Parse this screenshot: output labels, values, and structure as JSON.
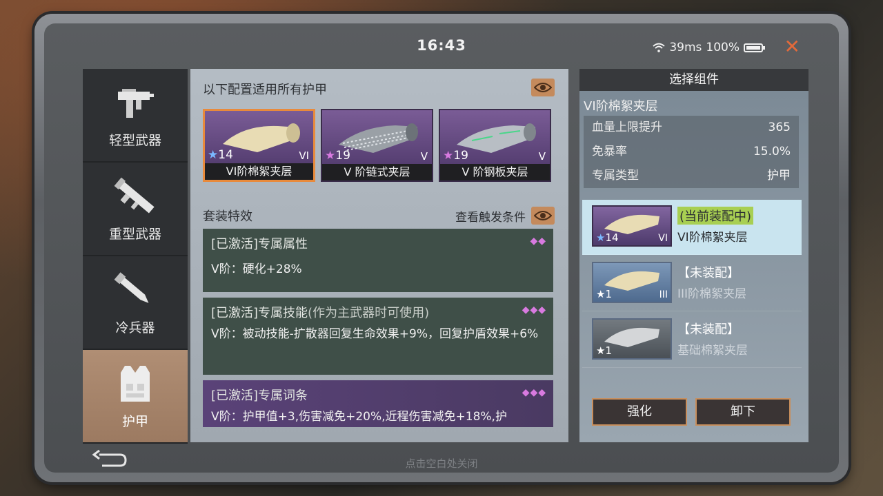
{
  "status": {
    "time": "16:43",
    "ping": "39ms",
    "battery": "100%"
  },
  "sidebar": {
    "items": [
      {
        "label": "轻型武器",
        "icon": "smg-icon"
      },
      {
        "label": "重型武器",
        "icon": "launcher-icon"
      },
      {
        "label": "冷兵器",
        "icon": "knife-icon"
      },
      {
        "label": "护甲",
        "icon": "vest-icon"
      }
    ]
  },
  "main": {
    "title": "以下配置适用所有护甲",
    "cards": [
      {
        "stars": "14",
        "tier": "VI",
        "name": "VI阶棉絮夹层"
      },
      {
        "stars": "19",
        "tier": "V",
        "name": "V 阶链式夹层"
      },
      {
        "stars": "19",
        "tier": "V",
        "name": "V 阶钢板夹层"
      }
    ],
    "set_title": "套装特效",
    "trigger_label": "查看触发条件",
    "effects": [
      {
        "head": "[已激活]专属属性",
        "sub": "",
        "dots": "◆◆",
        "body": "V阶：硬化+28%"
      },
      {
        "head": "[已激活]专属技能",
        "sub": "(作为主武器时可使用)",
        "dots": "◆◆◆",
        "body": "V阶：被动技能-扩散器回复生命效果+9%，回复护盾效果+6%"
      },
      {
        "head": "[已激活]专属词条",
        "sub": "",
        "dots": "◆◆◆",
        "body": "V阶：护甲值+3,伤害减免+20%,近程伤害减免+18%,护"
      }
    ]
  },
  "panel": {
    "header": "选择组件",
    "subtitle": "VI阶棉絮夹层",
    "stats": [
      {
        "k": "血量上限提升",
        "v": "365"
      },
      {
        "k": "免暴率",
        "v": "15.0%"
      },
      {
        "k": "专属类型",
        "v": "护甲"
      }
    ],
    "components": [
      {
        "tag": "(当前装配中)",
        "name": "VI阶棉絮夹层",
        "stars": "14",
        "tier": "VI"
      },
      {
        "tag": "【未装配】",
        "name": "III阶棉絮夹层",
        "stars": "1",
        "tier": "III"
      },
      {
        "tag": "【未装配】",
        "name": "基础棉絮夹层",
        "stars": "1",
        "tier": ""
      }
    ],
    "btn_upgrade": "强化",
    "btn_unequip": "卸下"
  },
  "footer": "点击空白处关闭",
  "colors": {
    "accent": "#e88a3c",
    "active_tab": "#a6836a",
    "equipped_tag": "#a8cf52"
  }
}
